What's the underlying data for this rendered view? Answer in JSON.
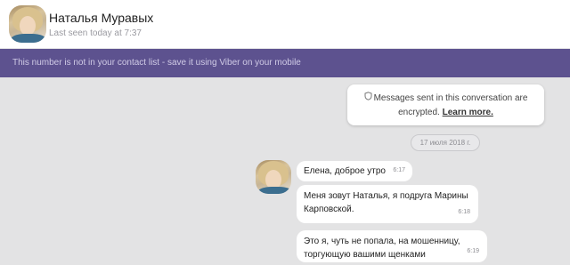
{
  "header": {
    "contact_name": "Наталья Муравых",
    "last_seen": "Last seen today at 7:37"
  },
  "banner": {
    "text": "This number is not in your contact list - save it using Viber on your mobile"
  },
  "encryption": {
    "line1": "Messages sent in this conversation are",
    "line2_prefix": "encrypted.",
    "link": "Learn more."
  },
  "date_separator": "17 июля 2018 г.",
  "messages": [
    {
      "text": "Елена, доброе утро",
      "time": "6:17"
    },
    {
      "text": "Меня зовут Наталья, я подруга Марины Карповской.",
      "time": "6:18"
    },
    {
      "text": "Это я, чуть не попала, на мошенницу, торгующую вашими щенками",
      "time": "6:19"
    }
  ],
  "icons": {
    "encryption": "shield-icon"
  }
}
